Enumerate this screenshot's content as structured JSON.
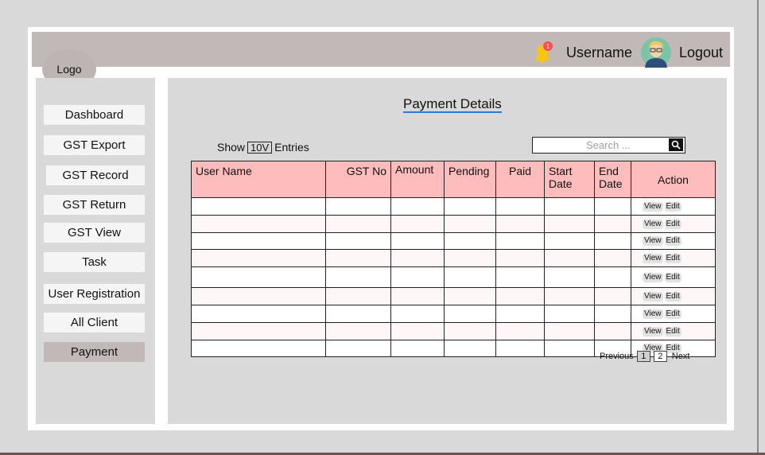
{
  "header": {
    "logo": "Logo",
    "username": "Username",
    "logout": "Logout",
    "notification_count": "1"
  },
  "sidebar": {
    "items": [
      {
        "label": "Dashboard"
      },
      {
        "label": "GST Export"
      },
      {
        "label": "GST Record"
      },
      {
        "label": "GST Return"
      },
      {
        "label": "GST View"
      },
      {
        "label": "Task"
      },
      {
        "label": "User Registration"
      },
      {
        "label": "All Client"
      },
      {
        "label": "Payment",
        "active": true
      }
    ]
  },
  "main": {
    "title": "Payment Details",
    "show_label": "Show",
    "entries_value": "10V",
    "entries_label": "Entries",
    "search_placeholder": "Search ...",
    "table": {
      "columns": [
        "User Name",
        "GST No",
        "Amount",
        "Pending",
        "Paid",
        "Start Date",
        "End Date",
        "Action"
      ],
      "row_count": 9,
      "actions": [
        "View",
        "Edit"
      ]
    },
    "pagination": {
      "previous": "Previous",
      "pages": [
        "1",
        "2"
      ],
      "current": "1",
      "next": "Next"
    }
  },
  "colors": {
    "topbar": "#c1b8b8",
    "table_header": "#ffbcbc",
    "title_underline": "#2e7bd8",
    "active_nav": "#c1b8b8"
  }
}
